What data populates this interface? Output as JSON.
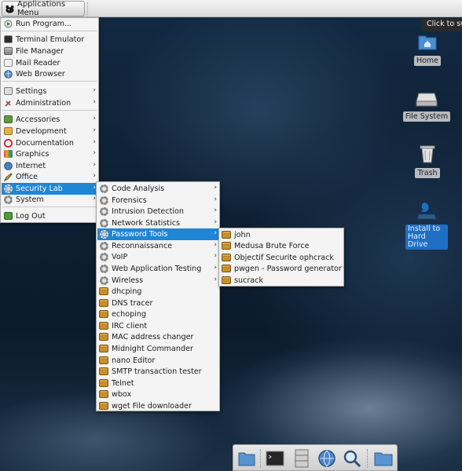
{
  "top_panel": {
    "app_menu_label": "Applications Menu",
    "tooltip": "Click to sw"
  },
  "main_menu": {
    "items": [
      {
        "label": "Run Program...",
        "icon": "run-icon"
      },
      {
        "label": "Terminal Emulator",
        "icon": "terminal-icon"
      },
      {
        "label": "File Manager",
        "icon": "file-manager-icon"
      },
      {
        "label": "Mail Reader",
        "icon": "mail-icon"
      },
      {
        "label": "Web Browser",
        "icon": "globe-icon"
      },
      {
        "label": "Settings",
        "icon": "settings-icon"
      },
      {
        "label": "Administration",
        "icon": "tools-icon"
      },
      {
        "label": "Accessories",
        "icon": "accessories-icon"
      },
      {
        "label": "Development",
        "icon": "development-icon"
      },
      {
        "label": "Documentation",
        "icon": "documentation-icon"
      },
      {
        "label": "Graphics",
        "icon": "graphics-icon"
      },
      {
        "label": "Internet",
        "icon": "internet-icon"
      },
      {
        "label": "Office",
        "icon": "office-icon"
      },
      {
        "label": "Security Lab",
        "icon": "gear-icon"
      },
      {
        "label": "System",
        "icon": "gear-icon"
      },
      {
        "label": "Log Out",
        "icon": "logout-icon"
      }
    ]
  },
  "security_menu": {
    "items": [
      {
        "label": "Code Analysis"
      },
      {
        "label": "Forensics"
      },
      {
        "label": "Intrusion Detection"
      },
      {
        "label": "Network Statistics"
      },
      {
        "label": "Password Tools"
      },
      {
        "label": "Reconnaissance"
      },
      {
        "label": "VoIP"
      },
      {
        "label": "Web Application Testing"
      },
      {
        "label": "Wireless"
      },
      {
        "label": "dhcping"
      },
      {
        "label": "DNS tracer"
      },
      {
        "label": "echoping"
      },
      {
        "label": "IRC client"
      },
      {
        "label": "MAC address changer"
      },
      {
        "label": "Midnight Commander"
      },
      {
        "label": "nano Editor"
      },
      {
        "label": "SMTP transaction tester"
      },
      {
        "label": "Telnet"
      },
      {
        "label": "wbox"
      },
      {
        "label": "wget File downloader"
      }
    ]
  },
  "password_menu": {
    "items": [
      {
        "label": "john"
      },
      {
        "label": "Medusa Brute Force"
      },
      {
        "label": "Objectif Securite ophcrack"
      },
      {
        "label": "pwgen - Password generator"
      },
      {
        "label": "sucrack"
      }
    ]
  },
  "desktop_icons": {
    "home": "Home",
    "filesystem": "File System",
    "trash": "Trash",
    "install": "Install to Hard Drive"
  },
  "colors": {
    "highlight": "#1f86d6",
    "menu_bg": "#f4f4f4"
  }
}
